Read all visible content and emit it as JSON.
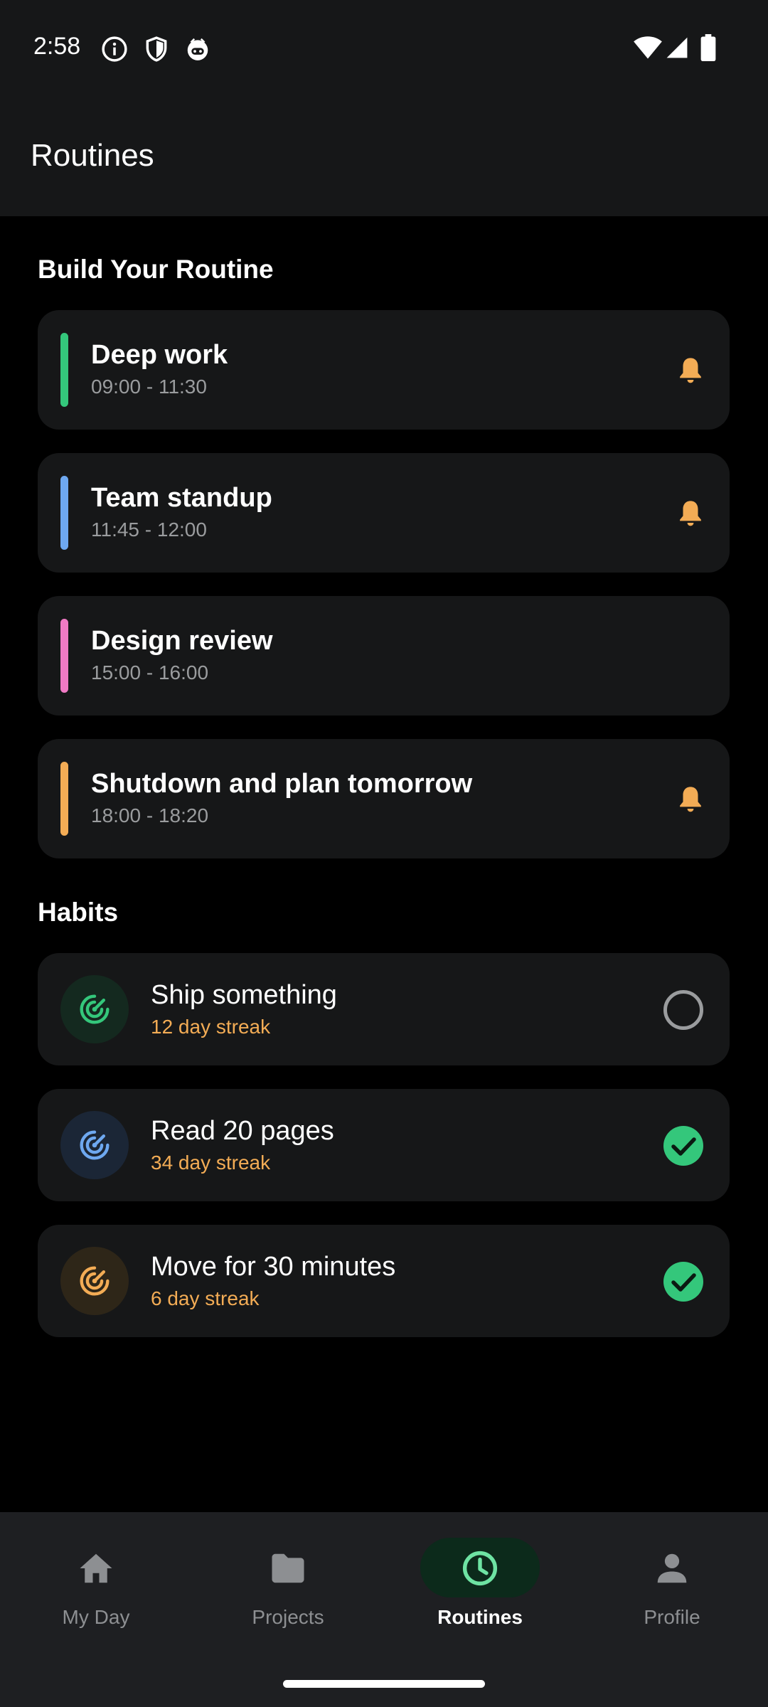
{
  "status_bar": {
    "time": "2:58",
    "left_icons": [
      "info-icon",
      "shield-icon",
      "assistant-icon"
    ],
    "right_icons": [
      "wifi-icon",
      "cellular-signal-icon",
      "battery-icon"
    ]
  },
  "app_bar": {
    "title": "Routines"
  },
  "routines": {
    "heading": "Build Your Routine",
    "items": [
      {
        "name": "Deep work",
        "time": "09:00 - 11:30",
        "color": "#34c77b",
        "reminder": true
      },
      {
        "name": "Team standup",
        "time": "11:45 - 12:00",
        "color": "#6ea8f0",
        "reminder": true
      },
      {
        "name": "Design review",
        "time": "15:00 - 16:00",
        "color": "#f07ac4",
        "reminder": false
      },
      {
        "name": "Shutdown and plan tomorrow",
        "time": "18:00 - 18:20",
        "color": "#f3ac55",
        "reminder": true
      }
    ]
  },
  "habits": {
    "heading": "Habits",
    "items": [
      {
        "name": "Ship something",
        "streak": "12 day streak",
        "color": "#34c77b",
        "icon_bg": "#14291f",
        "done": false
      },
      {
        "name": "Read 20 pages",
        "streak": "34 day streak",
        "color": "#6ea8f0",
        "icon_bg": "#1b2636",
        "done": true
      },
      {
        "name": "Move for 30 minutes",
        "streak": "6 day streak",
        "color": "#f3ac55",
        "icon_bg": "#2e2618",
        "done": true
      }
    ]
  },
  "bottom_nav": {
    "items": [
      {
        "label": "My Day",
        "icon": "home-icon",
        "active": false
      },
      {
        "label": "Projects",
        "icon": "folder-icon",
        "active": false
      },
      {
        "label": "Routines",
        "icon": "clock-icon",
        "active": true
      },
      {
        "label": "Profile",
        "icon": "person-icon",
        "active": false
      }
    ]
  },
  "colors": {
    "accent": "#34c77b",
    "reminder_bell": "#f3ac55",
    "streak_text": "#f3ac55",
    "card_bg": "#161718",
    "page_bg": "#000000"
  }
}
